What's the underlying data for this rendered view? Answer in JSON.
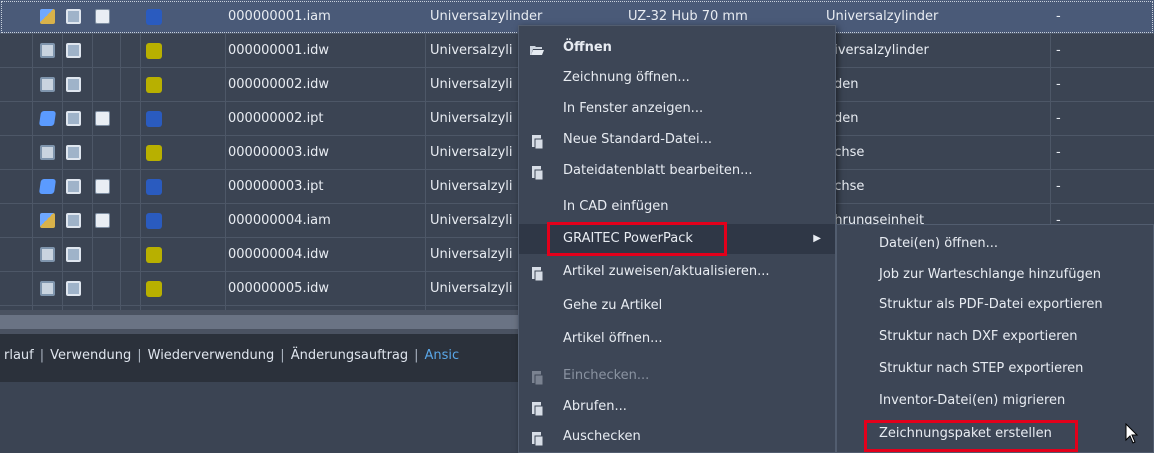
{
  "rows": [
    {
      "icons": [
        "asm",
        "drw",
        "doc"
      ],
      "color": "#2a5bbf",
      "filename": "000000001.iam",
      "title": "Universalzylinder",
      "desc": "UZ-32 Hub 70 mm",
      "category": "Universalzylinder",
      "extra": "-",
      "selected": true
    },
    {
      "icons": [
        "drw2",
        "drw"
      ],
      "color": "#b8b000",
      "filename": "000000001.idw",
      "title": "Universalzyli",
      "desc": "",
      "category": "niversalzylinder",
      "extra": "-",
      "selected": false
    },
    {
      "icons": [
        "drw2",
        "drw"
      ],
      "color": "#b8b000",
      "filename": "000000002.idw",
      "title": "Universalzyli",
      "desc": "",
      "category": "oden",
      "extra": "-",
      "selected": false
    },
    {
      "icons": [
        "prt",
        "drw",
        "doc"
      ],
      "color": "#2a5bbf",
      "filename": "000000002.ipt",
      "title": "Universalzyli",
      "desc": "",
      "category": "oden",
      "extra": "-",
      "selected": false
    },
    {
      "icons": [
        "drw2",
        "drw"
      ],
      "color": "#b8b000",
      "filename": "000000003.idw",
      "title": "Universalzyli",
      "desc": "",
      "category": "uchse",
      "extra": "-",
      "selected": false
    },
    {
      "icons": [
        "prt",
        "drw",
        "doc"
      ],
      "color": "#2a5bbf",
      "filename": "000000003.ipt",
      "title": "Universalzyli",
      "desc": "",
      "category": "uchse",
      "extra": "-",
      "selected": false
    },
    {
      "icons": [
        "asm",
        "drw",
        "doc"
      ],
      "color": "#2a5bbf",
      "filename": "000000004.iam",
      "title": "Universalzyli",
      "desc": "",
      "category": "ührungseinheit",
      "extra": "-",
      "selected": false
    },
    {
      "icons": [
        "drw2",
        "drw"
      ],
      "color": "#b8b000",
      "filename": "000000004.idw",
      "title": "Universalzyli",
      "desc": "",
      "category": "",
      "extra": "",
      "selected": false
    },
    {
      "icons": [
        "drw2",
        "drw"
      ],
      "color": "#b8b000",
      "filename": "000000005.idw",
      "title": "Universalzyli",
      "desc": "",
      "category": "",
      "extra": "",
      "selected": false
    }
  ],
  "bottom_tabs": {
    "items": [
      "rlauf",
      "Verwendung",
      "Wiederverwendung",
      "Änderungsauftrag"
    ],
    "partial_link": "Ansic"
  },
  "context_menu": {
    "items": [
      {
        "label": "Öffnen",
        "icon": "folder-open-icon",
        "bold": true,
        "disabled": false
      },
      {
        "label": "Zeichnung öffnen...",
        "icon": "",
        "bold": false,
        "disabled": false
      },
      {
        "label": "In Fenster anzeigen...",
        "icon": "",
        "bold": false,
        "disabled": false
      },
      {
        "label": "Neue Standard-Datei...",
        "icon": "new-file-icon",
        "bold": false,
        "disabled": false
      },
      {
        "label": "Dateidatenblatt bearbeiten...",
        "icon": "datasheet-icon",
        "bold": false,
        "disabled": false
      },
      {
        "label": "In CAD einfügen",
        "icon": "",
        "bold": false,
        "disabled": false
      },
      {
        "label": "GRAITEC PowerPack",
        "icon": "",
        "bold": false,
        "disabled": false,
        "submenu": true
      },
      {
        "label": "Artikel zuweisen/aktualisieren...",
        "icon": "assign-item-icon",
        "bold": false,
        "disabled": false
      },
      {
        "label": "Gehe zu Artikel",
        "icon": "",
        "bold": false,
        "disabled": false
      },
      {
        "label": "Artikel öffnen...",
        "icon": "",
        "bold": false,
        "disabled": false
      },
      {
        "label": "Einchecken...",
        "icon": "checkin-icon",
        "bold": false,
        "disabled": true
      },
      {
        "label": "Abrufen...",
        "icon": "get-icon",
        "bold": false,
        "disabled": false
      },
      {
        "label": "Auschecken",
        "icon": "checkout-icon",
        "bold": false,
        "disabled": false
      }
    ]
  },
  "submenu": {
    "items": [
      "Datei(en) öffnen...",
      "Job zur Warteschlange hinzufügen",
      "Struktur als PDF-Datei exportieren",
      "Struktur nach DXF exportieren",
      "Struktur nach STEP exportieren",
      "Inventor-Datei(en) migrieren",
      "Zeichnungspaket erstellen"
    ]
  },
  "colors": {
    "highlight_box": "#e3001b",
    "link": "#5aa7e8"
  }
}
